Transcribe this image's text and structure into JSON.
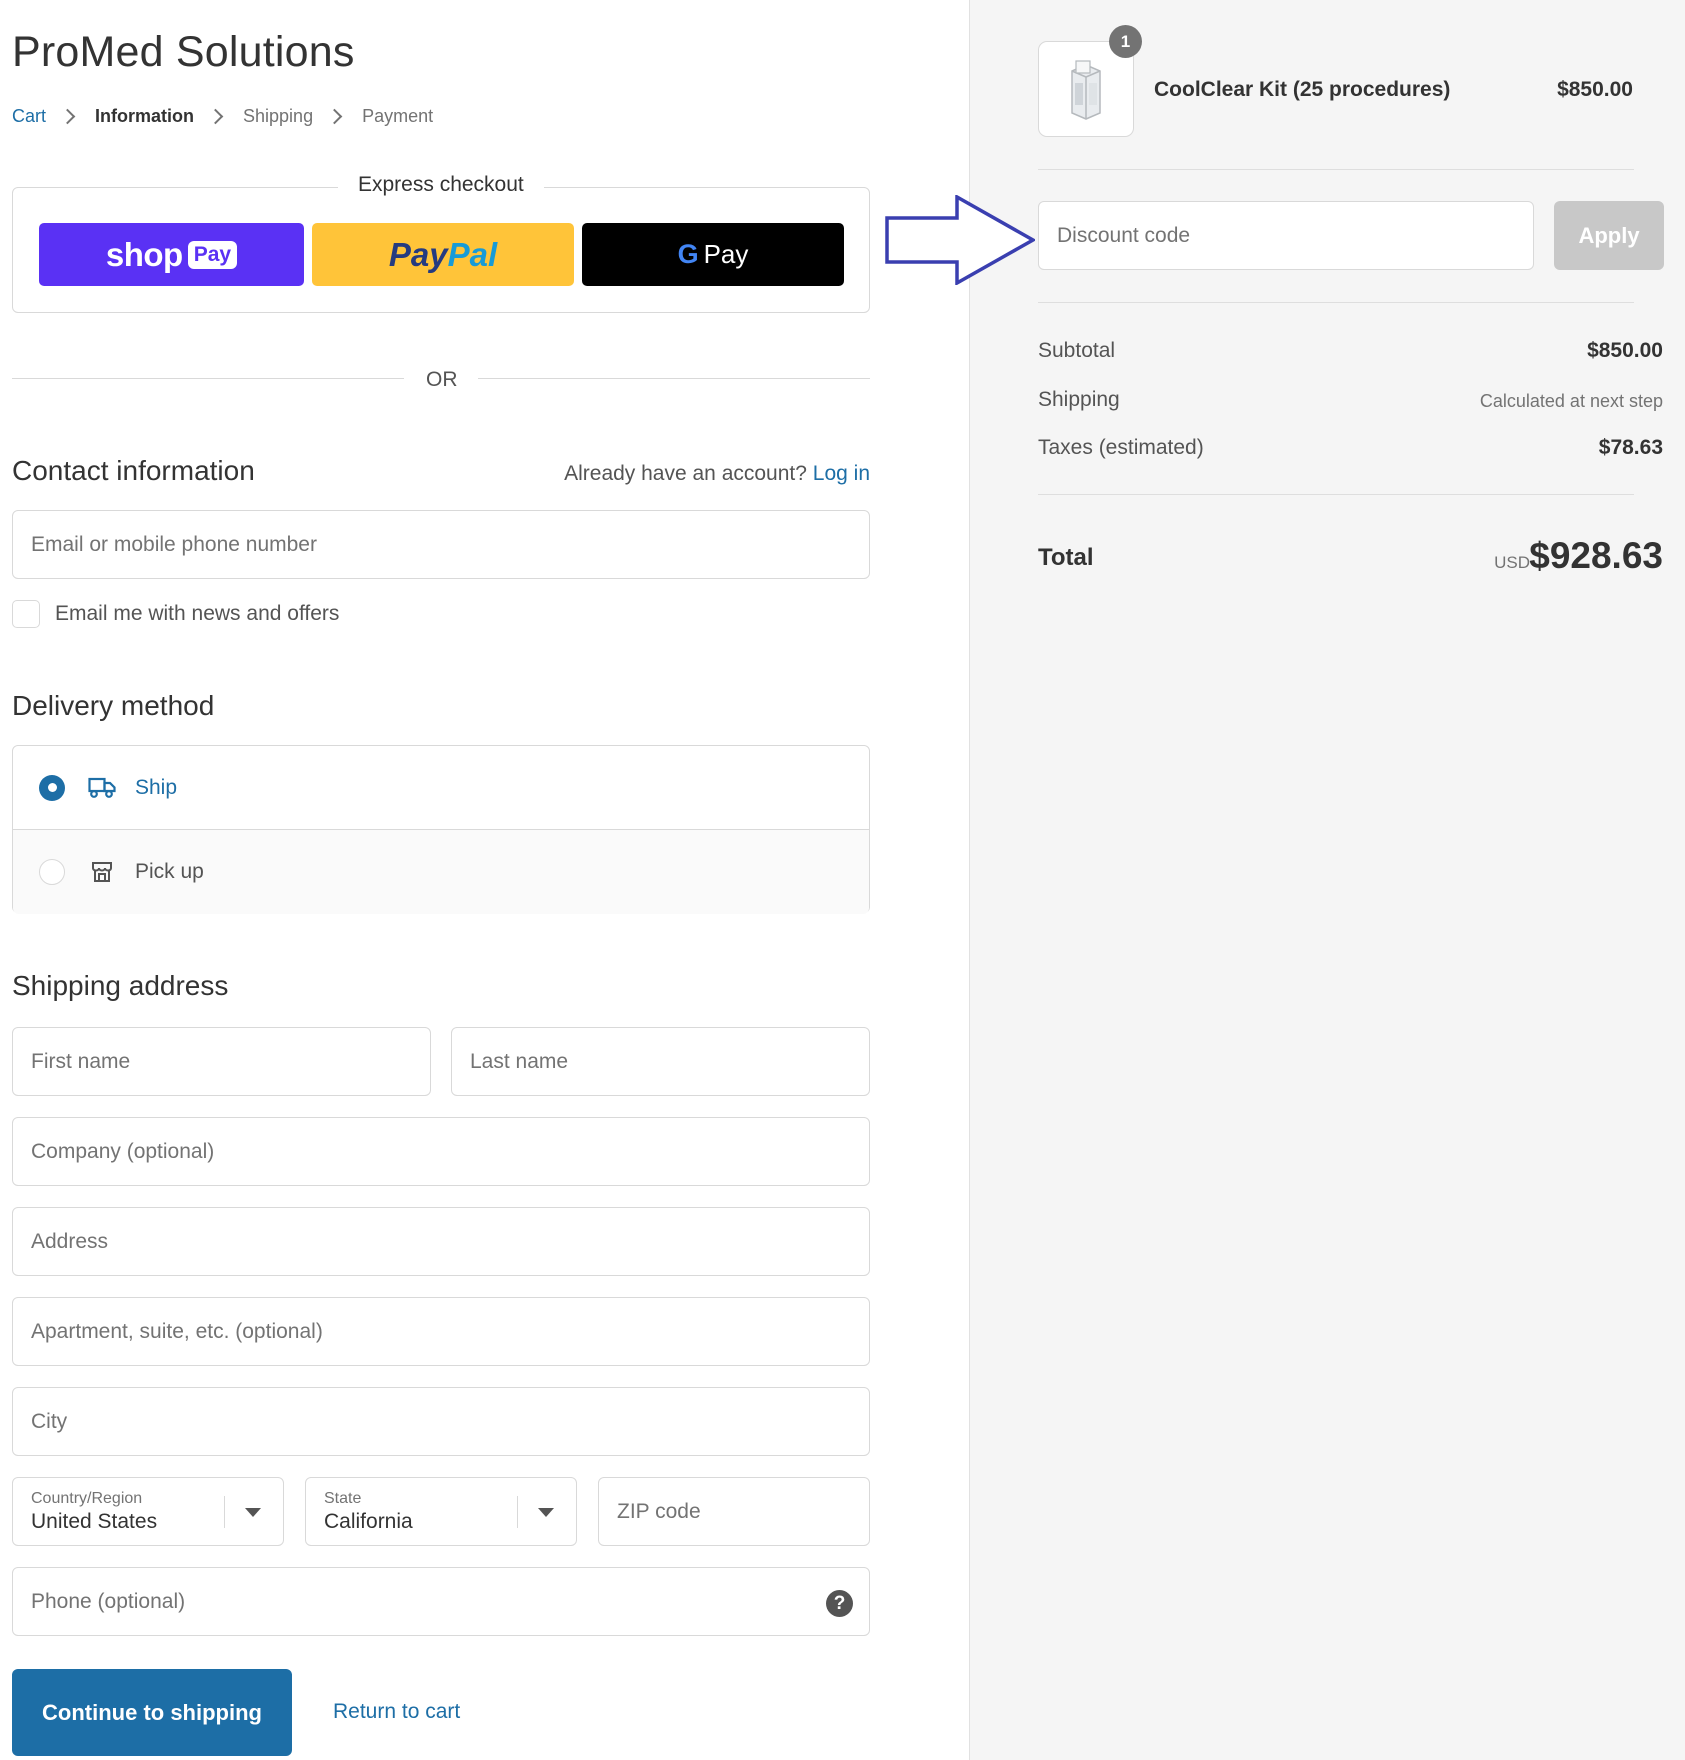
{
  "store": {
    "title": "ProMed Solutions"
  },
  "breadcrumb": [
    {
      "label": "Cart",
      "state": "link"
    },
    {
      "label": "Information",
      "state": "current"
    },
    {
      "label": "Shipping",
      "state": "upcoming"
    },
    {
      "label": "Payment",
      "state": "upcoming"
    }
  ],
  "express": {
    "label": "Express checkout",
    "shop_pay": {
      "word": "shop",
      "chip": "Pay"
    },
    "paypal": {
      "part1": "Pay",
      "part2": "Pal"
    },
    "gpay": {
      "g": "G",
      "pay": "Pay"
    }
  },
  "divider": {
    "or": "OR"
  },
  "contact": {
    "title": "Contact information",
    "account_prompt": "Already have an account?",
    "login": "Log in",
    "email_placeholder": "Email or mobile phone number",
    "newsletter_label": "Email me with news and offers"
  },
  "delivery": {
    "title": "Delivery method",
    "options": [
      {
        "label": "Ship",
        "selected": true
      },
      {
        "label": "Pick up",
        "selected": false
      }
    ]
  },
  "shipping": {
    "title": "Shipping address",
    "first_name": "First name",
    "last_name": "Last name",
    "company": "Company (optional)",
    "address": "Address",
    "apartment": "Apartment, suite, etc. (optional)",
    "city": "City",
    "country_label": "Country/Region",
    "country_value": "United States",
    "state_label": "State",
    "state_value": "California",
    "zip": "ZIP code",
    "phone": "Phone (optional)",
    "help": "?"
  },
  "actions": {
    "continue": "Continue to shipping",
    "return": "Return to cart"
  },
  "summary": {
    "item": {
      "name": "CoolClear Kit (25 procedures)",
      "price": "$850.00",
      "quantity": "1"
    },
    "discount_placeholder": "Discount code",
    "apply": "Apply",
    "subtotal_label": "Subtotal",
    "subtotal_value": "$850.00",
    "shipping_label": "Shipping",
    "shipping_value": "Calculated at next step",
    "taxes_label": "Taxes (estimated)",
    "taxes_value": "$78.63",
    "total_label": "Total",
    "currency": "USD",
    "total_value": "$928.63"
  },
  "colors": {
    "accent": "#1d6ea6",
    "shop_pay": "#5a31f4",
    "paypal": "#ffc439",
    "gpay": "#000000",
    "annotation_arrow": "#3a3fb0"
  }
}
